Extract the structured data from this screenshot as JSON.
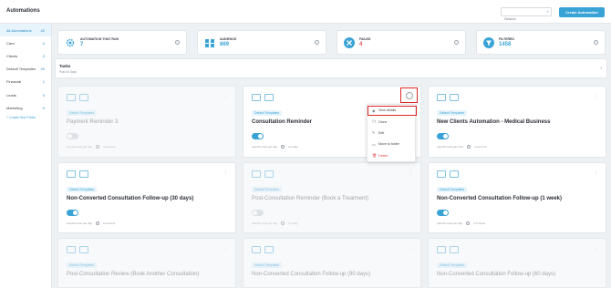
{
  "header": {
    "title": "Automations",
    "search_placeholder": "Search",
    "create_label": "Create Automation"
  },
  "sidebar": {
    "items": [
      {
        "label": "All Automations",
        "count": "42"
      },
      {
        "label": "Care",
        "count": "0"
      },
      {
        "label": "Clients",
        "count": "0"
      },
      {
        "label": "Default Templates",
        "count": "42"
      },
      {
        "label": "Financial",
        "count": "1"
      },
      {
        "label": "Leads",
        "count": "0"
      },
      {
        "label": "Marketing",
        "count": "0"
      }
    ],
    "create_folder": "+ Create New Folder"
  },
  "stats": [
    {
      "label": "AUTOMATION THAT RUN",
      "value": "7"
    },
    {
      "label": "AUDIENCE",
      "value": "869"
    },
    {
      "label": "FAILED",
      "value": "4"
    },
    {
      "label": "FILTERED",
      "value": "1458"
    }
  ],
  "tasks": {
    "title": "Tasks",
    "subtitle": "Past 30 Days"
  },
  "cards": [
    {
      "tag": "Default Templates",
      "name": "Payment Reminder 3",
      "on": false,
      "meta1": "Launch once per day",
      "meta2": "in an hour"
    },
    {
      "tag": "Default Templates",
      "name": "Consultation Reminder",
      "on": true,
      "meta1": "Launch once per day",
      "meta2": "in a day"
    },
    {
      "tag": "Default Templates",
      "name": "New Clients Automation - Medical Business",
      "on": true,
      "meta1": "Launch once per hour",
      "meta2": "in an hour"
    },
    {
      "tag": "Default Templates",
      "name": "Non-Converted Consultation Follow-up (30 days)",
      "on": true,
      "meta1": "Launch once per day",
      "meta2": "in an hour"
    },
    {
      "tag": "Default Templates",
      "name": "Post-Consultation Reminder (Book a Treatment)",
      "on": false,
      "meta1": "Launch once per day",
      "meta2": "in a day"
    },
    {
      "tag": "Default Templates",
      "name": "Non-Converted Consultation Follow-up (1 week)",
      "on": true,
      "meta1": "Launch once per day",
      "meta2": "in 3 hours"
    },
    {
      "tag": "Default Templates",
      "name": "Post-Consultation Review (Book Another Consultation)",
      "on": false,
      "meta1": "",
      "meta2": ""
    },
    {
      "tag": "Default Templates",
      "name": "Non-Converted Consultation Follow-up (90 days)",
      "on": false,
      "meta1": "",
      "meta2": ""
    },
    {
      "tag": "Default Templates",
      "name": "Non-Converted Consultation Follow-up (60 days)",
      "on": false,
      "meta1": "",
      "meta2": ""
    }
  ],
  "menu": {
    "view": "View details",
    "clone": "Clone",
    "edit": "Edit",
    "move": "Move to folder",
    "delete": "Delete"
  }
}
